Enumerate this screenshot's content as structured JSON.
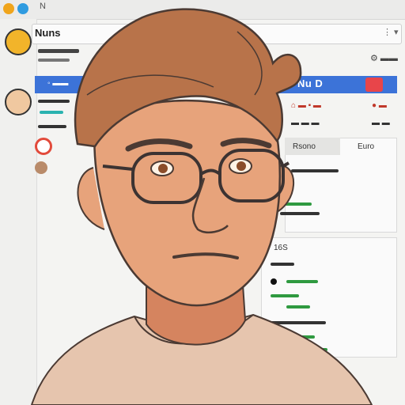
{
  "window": {
    "title": "N"
  },
  "address_bar": {
    "text": "Nuns"
  },
  "header": {
    "nav_text": "Ie Nu D"
  },
  "panels": {
    "right_head_left": "Rsono",
    "right_head_right": "Euro",
    "section_label": "16S"
  },
  "colors": {
    "accent_blue": "#3c73d8",
    "accent_red": "#e8454a",
    "accent_teal": "#2bb3b0",
    "link_red": "#c0392b",
    "green": "#2f9a40",
    "skin": "#e7a37b",
    "hair": "#b8734a",
    "shirt": "#e7c8b2"
  },
  "icons": [
    "gear-icon",
    "avatar-icon",
    "settings-icon"
  ]
}
